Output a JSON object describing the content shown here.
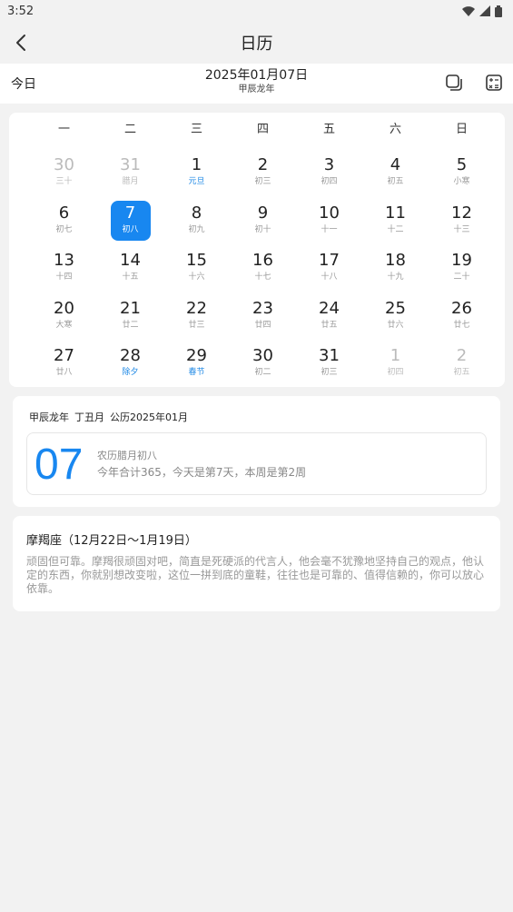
{
  "status": {
    "time": "3:52"
  },
  "header": {
    "title": "日历",
    "back_icon": "back-arrow-icon"
  },
  "toolbar": {
    "today_label": "今日",
    "date": "2025年01月07日",
    "lunar_year": "甲辰龙年",
    "copy_icon": "copy-icon",
    "calculator_icon": "calculator-icon"
  },
  "calendar": {
    "weekdays": [
      "一",
      "二",
      "三",
      "四",
      "五",
      "六",
      "日"
    ],
    "weeks": [
      [
        {
          "num": "30",
          "lunar": "三十",
          "muted": true
        },
        {
          "num": "31",
          "lunar": "腊月",
          "muted": true
        },
        {
          "num": "1",
          "lunar": "元旦",
          "festival": true
        },
        {
          "num": "2",
          "lunar": "初三"
        },
        {
          "num": "3",
          "lunar": "初四"
        },
        {
          "num": "4",
          "lunar": "初五"
        },
        {
          "num": "5",
          "lunar": "小寒"
        }
      ],
      [
        {
          "num": "6",
          "lunar": "初七"
        },
        {
          "num": "7",
          "lunar": "初八",
          "selected": true
        },
        {
          "num": "8",
          "lunar": "初九"
        },
        {
          "num": "9",
          "lunar": "初十"
        },
        {
          "num": "10",
          "lunar": "十一"
        },
        {
          "num": "11",
          "lunar": "十二"
        },
        {
          "num": "12",
          "lunar": "十三"
        }
      ],
      [
        {
          "num": "13",
          "lunar": "十四"
        },
        {
          "num": "14",
          "lunar": "十五"
        },
        {
          "num": "15",
          "lunar": "十六"
        },
        {
          "num": "16",
          "lunar": "十七"
        },
        {
          "num": "17",
          "lunar": "十八"
        },
        {
          "num": "18",
          "lunar": "十九"
        },
        {
          "num": "19",
          "lunar": "二十"
        }
      ],
      [
        {
          "num": "20",
          "lunar": "大寒"
        },
        {
          "num": "21",
          "lunar": "廿二"
        },
        {
          "num": "22",
          "lunar": "廿三"
        },
        {
          "num": "23",
          "lunar": "廿四"
        },
        {
          "num": "24",
          "lunar": "廿五"
        },
        {
          "num": "25",
          "lunar": "廿六"
        },
        {
          "num": "26",
          "lunar": "廿七"
        }
      ],
      [
        {
          "num": "27",
          "lunar": "廿八"
        },
        {
          "num": "28",
          "lunar": "除夕",
          "festival": true
        },
        {
          "num": "29",
          "lunar": "春节",
          "festival": true
        },
        {
          "num": "30",
          "lunar": "初二"
        },
        {
          "num": "31",
          "lunar": "初三"
        },
        {
          "num": "1",
          "lunar": "初四",
          "muted": true
        },
        {
          "num": "2",
          "lunar": "初五",
          "muted": true
        }
      ]
    ]
  },
  "info": {
    "ganzhi_year": "甲辰龙年",
    "ganzhi_month": "丁丑月",
    "gregorian": "公历2025年01月",
    "day": "07",
    "lunar_date": "农历腊月初八",
    "stats": "今年合计365，今天是第7天，本周是第2周"
  },
  "zodiac": {
    "title": "摩羯座（12月22日～1月19日）",
    "description": "顽固但可靠。摩羯很顽固对吧，简直是死硬派的代言人，他会毫不犹豫地坚持自己的观点，他认定的东西，你就别想改变啦，这位一拼到底的童鞋，往往也是可靠的、值得信赖的，你可以放心依靠。"
  },
  "colors": {
    "accent": "#1887f0",
    "festival": "#1e88e5",
    "background": "#f2f2f2"
  }
}
